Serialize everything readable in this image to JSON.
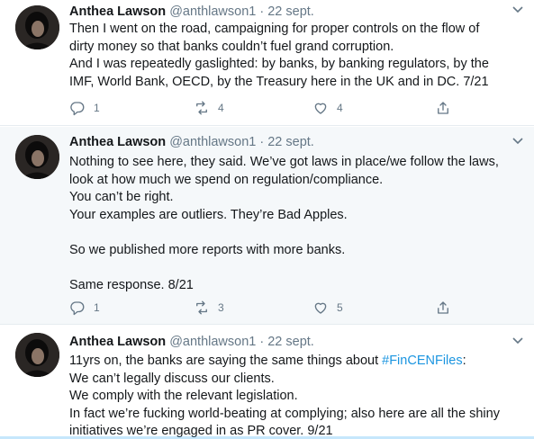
{
  "tweets": [
    {
      "name": "Anthea Lawson",
      "handle": "@anthlawson1",
      "date": "22 sept.",
      "lines": [
        "Then I went on the road, campaigning for proper controls on the flow of",
        "dirty money so that banks couldn’t fuel grand corruption.",
        "And I was repeatedly gaslighted: by banks, by banking regulators, by the",
        "IMF, World Bank, OECD, by the Treasury here in the UK and in DC. 7/21"
      ],
      "replies": "1",
      "retweets": "4",
      "likes": "4"
    },
    {
      "name": "Anthea Lawson",
      "handle": "@anthlawson1",
      "date": "22 sept.",
      "lines": [
        "Nothing to see here, they said. We’ve got laws in place/we follow the laws,",
        "look at how much we spend on regulation/compliance.",
        "You can’t be right.",
        "Your examples are outliers. They’re Bad Apples.",
        "",
        "So we published more reports with more banks.",
        "",
        "Same response. 8/21"
      ],
      "replies": "1",
      "retweets": "3",
      "likes": "5"
    },
    {
      "name": "Anthea Lawson",
      "handle": "@anthlawson1",
      "date": "22 sept.",
      "line1_prefix": "11yrs on, the banks are saying the same things about ",
      "hashtag": "#FinCENFiles",
      "line1_suffix": ":",
      "lines": [
        "We can’t legally discuss our clients.",
        "We comply with the relevant legislation.",
        "In fact we’re fucking world-beating at complying; also here are all the shiny",
        "initiatives we’re engaged in as PR cover. 9/21"
      ]
    }
  ],
  "icons": {
    "reply": "reply-icon",
    "retweet": "retweet-icon",
    "like": "heart-icon",
    "share": "share-icon",
    "caret": "chevron-down-icon"
  },
  "colors": {
    "text": "#14171a",
    "secondary": "#657786",
    "hashtag": "#1b95e0",
    "highlight_bg": "#f5f8fa",
    "border": "#e6ecf0"
  }
}
